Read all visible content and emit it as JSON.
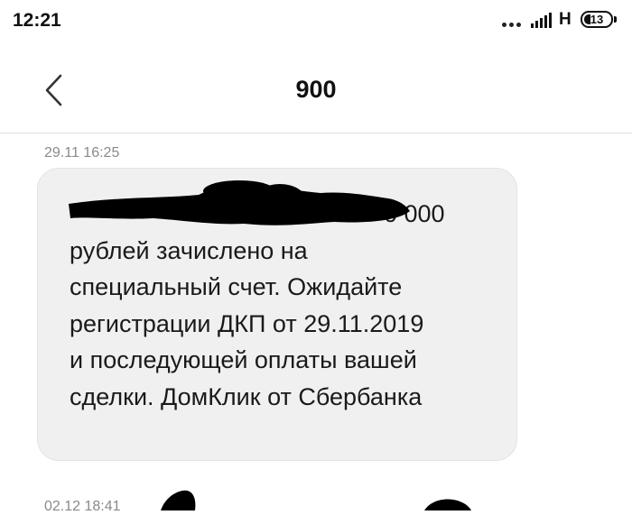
{
  "status_bar": {
    "time": "12:21",
    "network": "H",
    "battery": "13"
  },
  "header": {
    "title": "900",
    "back_icon": "chevron-left-icon"
  },
  "messages": [
    {
      "timestamp": "29.11 16:25",
      "text": "0 000\nрублей зачислено на\nспециальный счет. Ожидайте\nрегистрации ДКП от 29.11.2019\nи последующей оплаты вашей\nсделки. ДомКлик от Сбербанка"
    },
    {
      "timestamp": "02.12 18:41"
    }
  ],
  "colors": {
    "bubble": "#f0f0f0",
    "timestamp": "#8a8a8a",
    "redaction": "#000000"
  }
}
